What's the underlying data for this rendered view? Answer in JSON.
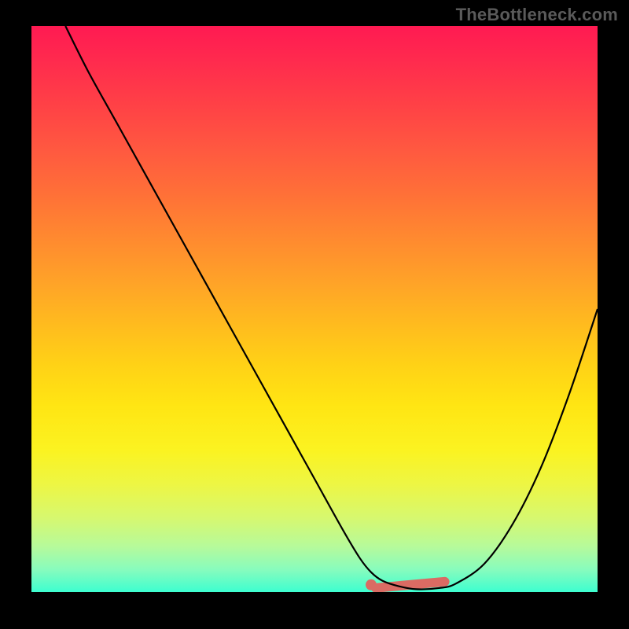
{
  "watermark": "TheBottleneck.com",
  "chart_data": {
    "type": "line",
    "title": "",
    "xlabel": "",
    "ylabel": "",
    "xlim": [
      0,
      100
    ],
    "ylim": [
      0,
      100
    ],
    "grid": false,
    "series": [
      {
        "name": "curve",
        "x": [
          6,
          10,
          15,
          20,
          25,
          30,
          35,
          40,
          45,
          50,
          55,
          58,
          60,
          62,
          65,
          68,
          72,
          75,
          80,
          85,
          90,
          95,
          100
        ],
        "values": [
          100,
          92,
          83,
          74,
          65,
          56,
          47,
          38,
          29,
          20,
          11,
          6,
          3.5,
          2,
          1,
          0.5,
          0.7,
          1.5,
          5,
          12,
          22,
          35,
          50
        ]
      }
    ],
    "highlight": {
      "xstart": 60,
      "xend": 73,
      "y": 1
    },
    "background_gradient": {
      "top": "#ff1a52",
      "mid": "#ffe513",
      "bottom": "#3dfed0"
    }
  }
}
